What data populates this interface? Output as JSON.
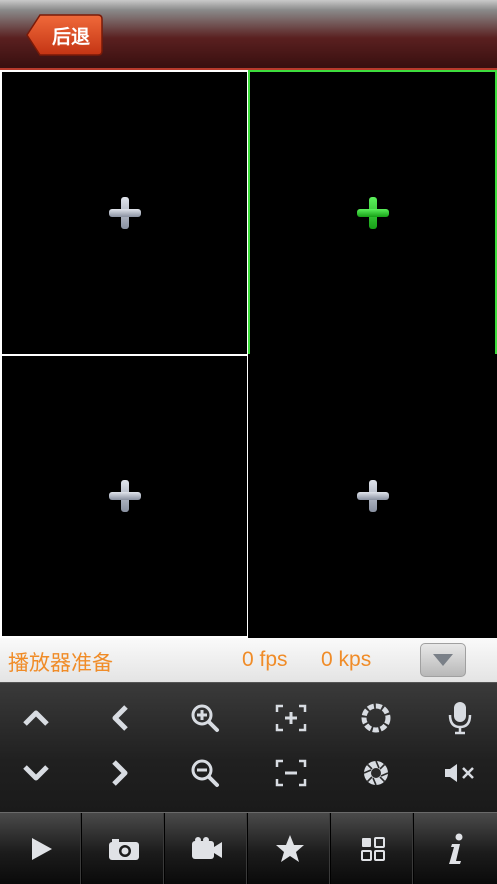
{
  "header": {
    "back_label": "后退"
  },
  "status": {
    "label": "播放器准备",
    "fps": "0 fps",
    "kps": "0 kps"
  },
  "colors": {
    "accent_orange": "#f08c28",
    "selected_green": "#3ddc3d",
    "header_red": "#b83a2c"
  },
  "grid": {
    "cells": [
      {
        "name": "video-cell-1",
        "selected": false
      },
      {
        "name": "video-cell-2",
        "selected": true
      },
      {
        "name": "video-cell-3",
        "selected": false
      },
      {
        "name": "video-cell-4",
        "selected": false
      }
    ]
  },
  "controls": {
    "row1": [
      "up-arrow-icon",
      "left-arrow-icon",
      "zoom-in-icon",
      "focus-plus-icon",
      "iris-open-icon",
      "microphone-icon"
    ],
    "row2": [
      "down-arrow-icon",
      "right-arrow-icon",
      "zoom-out-icon",
      "focus-minus-icon",
      "iris-close-icon",
      "mute-icon"
    ]
  },
  "toolbar": [
    "play-icon",
    "camera-icon",
    "video-camera-icon",
    "star-icon",
    "grid-layout-icon",
    "info-icon"
  ]
}
